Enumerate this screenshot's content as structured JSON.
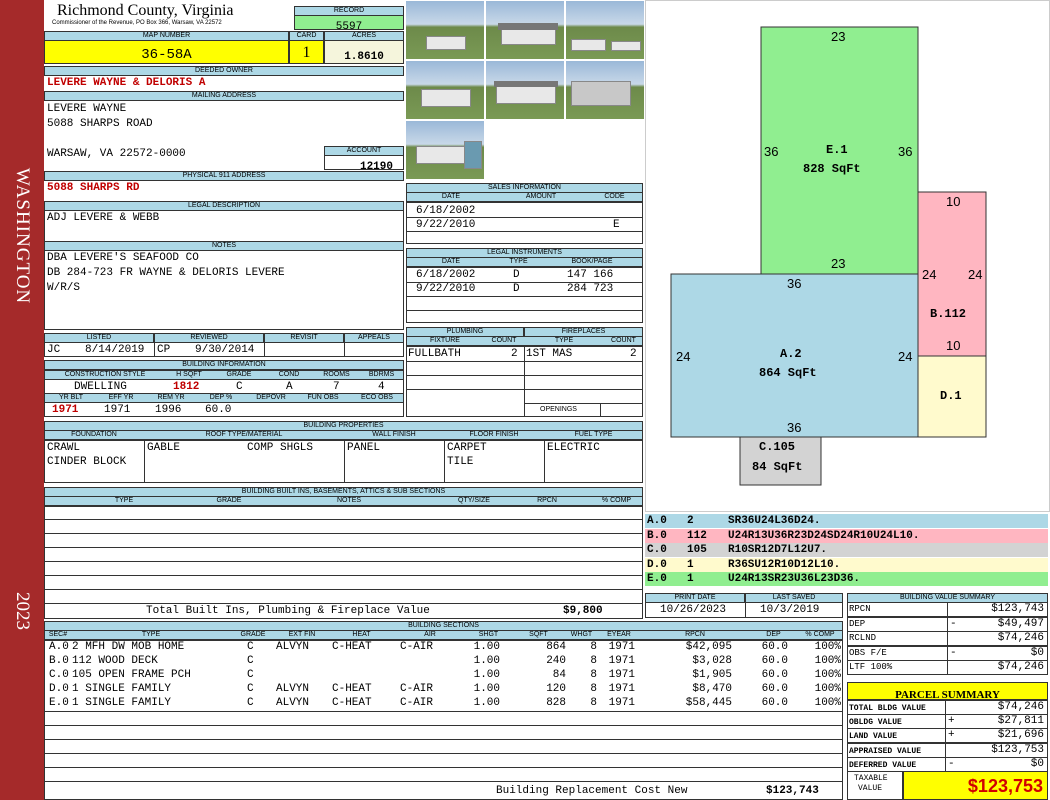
{
  "side_banner": {
    "name": "WASHINGTON",
    "year": "2023"
  },
  "header": {
    "county": "Richmond County, Virginia",
    "commissioner": "Commissioner of the Revenue, PO Box 366, Warsaw, VA 22572"
  },
  "record": {
    "label": "RECORD",
    "value": "5597"
  },
  "map": {
    "label": "MAP NUMBER",
    "value": "36-58A"
  },
  "card": {
    "label": "CARD",
    "value": "1"
  },
  "acres": {
    "label": "ACRES",
    "value": "1.8610"
  },
  "deeded_owner": {
    "label": "DEEDED OWNER",
    "value": "LEVERE WAYNE & DELORIS A"
  },
  "mailing": {
    "label": "MAILING ADDRESS",
    "line1": "LEVERE WAYNE",
    "line2": "5088 SHARPS ROAD",
    "line3": "WARSAW, VA 22572-0000"
  },
  "account": {
    "label": "ACCOUNT",
    "value": "12190"
  },
  "physical": {
    "label": "PHYSICAL 911 ADDRESS",
    "value": "5088 SHARPS RD"
  },
  "legal": {
    "label": "LEGAL DESCRIPTION",
    "value": "ADJ LEVERE & WEBB"
  },
  "notes": {
    "label": "NOTES",
    "line1": "DBA LEVERE'S SEAFOOD CO",
    "line2": "DB 284-723 FR WAYNE & DELORIS LEVERE",
    "line3": "W/R/S"
  },
  "listing": {
    "listed_label": "LISTED",
    "reviewed_label": "REVIEWED",
    "revisit_label": "REVISIT",
    "appeals_label": "APPEALS",
    "listed_by": "JC",
    "listed_date": "8/14/2019",
    "reviewed_by": "CP",
    "reviewed_date": "9/30/2014"
  },
  "building_info": {
    "label": "BUILDING INFORMATION",
    "h": [
      "CONSTRUCTION STYLE",
      "H SQFT",
      "GRADE",
      "COND",
      "ROOMS",
      "BDRMS"
    ],
    "v": [
      "DWELLING",
      "1812",
      "C",
      "A",
      "7",
      "4"
    ],
    "h2": [
      "YR BLT",
      "EFF YR",
      "REM YR",
      "DEP %",
      "DEPOVR",
      "FUN OBS",
      "ECO OBS"
    ],
    "v2": [
      "1971",
      "1971",
      "1996",
      "60.0",
      "",
      "",
      ""
    ]
  },
  "sales": {
    "label": "SALES INFORMATION",
    "cols": [
      "DATE",
      "AMOUNT",
      "CODE"
    ],
    "rows": [
      [
        "6/18/2002",
        "",
        ""
      ],
      [
        "9/22/2010",
        "",
        "E"
      ]
    ]
  },
  "legal_instr": {
    "label": "LEGAL INSTRUMENTS",
    "cols": [
      "DATE",
      "TYPE",
      "BOOK/PAGE"
    ],
    "rows": [
      [
        "6/18/2002",
        "D",
        "147 166"
      ],
      [
        "9/22/2010",
        "D",
        "284 723"
      ]
    ]
  },
  "plumbing": {
    "label": "PLUMBING",
    "cols": [
      "FIXTURE",
      "COUNT"
    ],
    "row": [
      "FULLBATH",
      "2"
    ]
  },
  "fireplaces": {
    "label": "FIREPLACES",
    "cols": [
      "TYPE",
      "COUNT"
    ],
    "row": [
      "1ST MAS",
      "2"
    ],
    "openings": "OPENINGS"
  },
  "props": {
    "label": "BUILDING PROPERTIES",
    "cols": [
      "FOUNDATION",
      "ROOF TYPE/MATERIAL",
      "WALL FINISH",
      "FLOOR FINISH",
      "FUEL TYPE"
    ],
    "foundation1": "CRAWL",
    "foundation2": "CINDER BLOCK",
    "roof1": "GABLE",
    "roof2": "COMP SHGLS",
    "wall": "PANEL",
    "floor1": "CARPET",
    "floor2": "TILE",
    "fuel": "ELECTRIC"
  },
  "builtins": {
    "label": "BUILDING BUILT INS, BASEMENTS, ATTICS & SUB SECTIONS",
    "cols": [
      "TYPE",
      "GRADE",
      "NOTES",
      "QTY/SIZE",
      "RPCN",
      "% COMP"
    ],
    "total_label": "Total Built Ins, Plumbing & Fireplace Value",
    "total_value": "$9,800"
  },
  "print": {
    "print_label": "PRINT DATE",
    "print_value": "10/26/2023",
    "saved_label": "LAST SAVED",
    "saved_value": "10/3/2019"
  },
  "sections": {
    "label": "BUILDING SECTIONS",
    "cols": [
      "SEC#",
      "TYPE",
      "GRADE",
      "EXT FIN",
      "HEAT",
      "AIR",
      "SHGT",
      "SQFT",
      "WHGT",
      "EYEAR",
      "RPCN",
      "DEP",
      "% COMP"
    ],
    "rows": [
      [
        "A.0",
        "2 MFH DW MOB HOME",
        "C",
        "ALVYN",
        "C-HEAT",
        "C-AIR",
        "1.00",
        "864",
        "8",
        "1971",
        "$42,095",
        "60.0",
        "100%"
      ],
      [
        "B.0",
        "112 WOOD DECK",
        "C",
        "",
        "",
        "",
        "1.00",
        "240",
        "8",
        "1971",
        "$3,028",
        "60.0",
        "100%"
      ],
      [
        "C.0",
        "105 OPEN FRAME PCH",
        "C",
        "",
        "",
        "",
        "1.00",
        "84",
        "8",
        "1971",
        "$1,905",
        "60.0",
        "100%"
      ],
      [
        "D.0",
        "1 SINGLE FAMILY",
        "C",
        "ALVYN",
        "C-HEAT",
        "C-AIR",
        "1.00",
        "120",
        "8",
        "1971",
        "$8,470",
        "60.0",
        "100%"
      ],
      [
        "E.0",
        "1 SINGLE FAMILY",
        "C",
        "ALVYN",
        "C-HEAT",
        "C-AIR",
        "1.00",
        "828",
        "8",
        "1971",
        "$58,445",
        "60.0",
        "100%"
      ]
    ],
    "replacement_label": "Building Replacement Cost New",
    "replacement_value": "$123,743"
  },
  "sketch": {
    "E": {
      "label": "E.1",
      "area": "828 SqFt",
      "top": "23",
      "left": "36",
      "right": "36",
      "bottom": "23"
    },
    "B": {
      "label": "B.112",
      "top": "10",
      "left": "24",
      "right": "24",
      "bottom": "10"
    },
    "A": {
      "label": "A.2",
      "area": "864 SqFt",
      "top": "36",
      "left": "24",
      "right": "24",
      "bottom": "36"
    },
    "D": {
      "label": "D.1"
    },
    "C": {
      "label": "C.105",
      "area": "84 SqFt"
    }
  },
  "legend": [
    {
      "code": "A.0",
      "num": "2",
      "path": "SR36U24L36D24.",
      "color": "#add8e6"
    },
    {
      "code": "B.0",
      "num": "112",
      "path": "U24R13U36R23D24SD24R10U24L10.",
      "color": "#ffb6c1"
    },
    {
      "code": "C.0",
      "num": "105",
      "path": "R10SR12D7L12U7.",
      "color": "#d3d3d3"
    },
    {
      "code": "D.0",
      "num": "1",
      "path": "R36SU12R10D12L10.",
      "color": "#fffacd"
    },
    {
      "code": "E.0",
      "num": "1",
      "path": "U24R13SR23U36L23D36.",
      "color": "#90ee90"
    }
  ],
  "value_summary": {
    "label": "BUILDING VALUE SUMMARY",
    "rows": [
      [
        "RPCN",
        "",
        "$123,743"
      ],
      [
        "DEP",
        "-",
        "$49,497"
      ],
      [
        "RCLND",
        "",
        "$74,246"
      ],
      [
        "OBS F/E",
        "-",
        "$0"
      ],
      [
        "LTF 100%",
        "",
        "$74,246"
      ]
    ]
  },
  "parcel": {
    "label": "PARCEL SUMMARY",
    "rows": [
      [
        "TOTAL BLDG VALUE",
        "",
        "$74,246"
      ],
      [
        "OBLDG VALUE",
        "+",
        "$27,811"
      ],
      [
        "LAND VALUE",
        "+",
        "$21,696"
      ],
      [
        "APPRAISED VALUE",
        "",
        "$123,753"
      ],
      [
        "DEFERRED VALUE",
        "-",
        "$0"
      ]
    ],
    "taxable_label1": "TAXABLE",
    "taxable_label2": "VALUE",
    "taxable_value": "$123,753"
  }
}
